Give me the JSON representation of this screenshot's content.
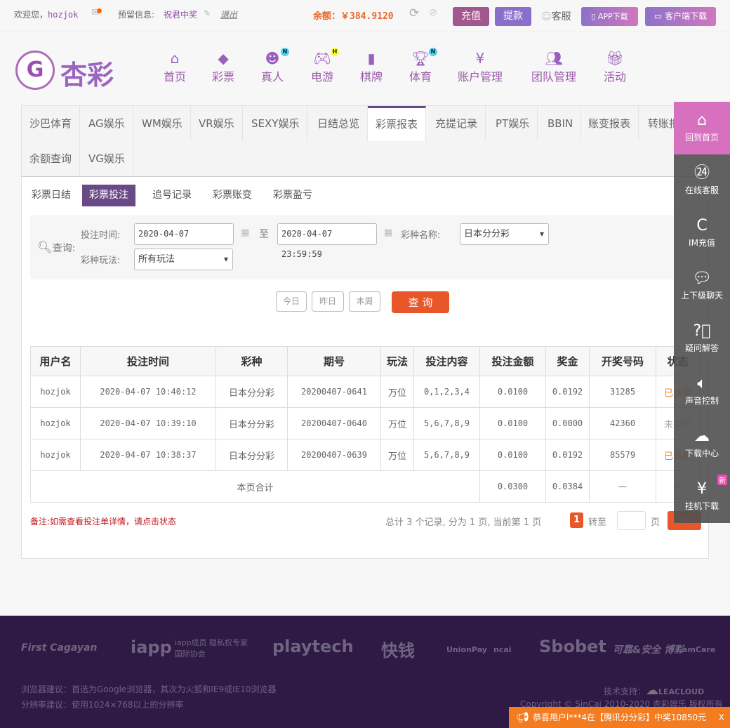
{
  "topbar": {
    "welcome": "欢迎您，",
    "username": "hozjok",
    "reserved_label": "预留信息:",
    "reserved_msg": "祝君中奖",
    "logout": "退出",
    "balance_label": "余额：",
    "balance": "￥384.9120",
    "recharge": "充值",
    "withdraw": "提款",
    "service": "客服",
    "app_download": "APP下载",
    "client_download": "客户端下载"
  },
  "brand": {
    "logo_text": "杏彩"
  },
  "nav": [
    {
      "label": "首页",
      "icon": "home-icon"
    },
    {
      "label": "彩票",
      "icon": "ticket-icon"
    },
    {
      "label": "真人",
      "icon": "live-dealer-icon",
      "badge": "N"
    },
    {
      "label": "电游",
      "icon": "gamepad-icon",
      "badge": "H"
    },
    {
      "label": "棋牌",
      "icon": "cards-icon"
    },
    {
      "label": "体育",
      "icon": "trophy-icon",
      "badge": "N"
    },
    {
      "label": "账户管理",
      "icon": "yen-icon"
    },
    {
      "label": "团队管理",
      "icon": "team-icon"
    },
    {
      "label": "活动",
      "icon": "gift-icon"
    }
  ],
  "tabs": [
    "沙巴体育",
    "AG娱乐",
    "WM娱乐",
    "VR娱乐",
    "SEXY娱乐",
    "日结总览",
    "彩票报表",
    "充提记录",
    "PT娱乐",
    "BBIN",
    "账变报表",
    "转账报表",
    "余额查询",
    "VG娱乐"
  ],
  "active_tab": "彩票报表",
  "subtabs": [
    "彩票日结",
    "彩票投注",
    "追号记录",
    "彩票账变",
    "彩票盈亏"
  ],
  "active_subtab": "彩票投注",
  "query": {
    "label": "查询:",
    "time_label": "投注时间:",
    "start": "2020-04-07 00:00:00",
    "to": "至",
    "end": "2020-04-07 23:59:59",
    "lottery_label": "彩种名称:",
    "lottery": "日本分分彩",
    "play_label": "彩种玩法:",
    "play": "所有玩法",
    "today": "今日",
    "yesterday": "昨日",
    "week": "本周",
    "submit": "查 询"
  },
  "table": {
    "headers": [
      "用户名",
      "投注时间",
      "彩种",
      "期号",
      "玩法",
      "投注内容",
      "投注金额",
      "奖金",
      "开奖号码",
      "状态"
    ],
    "rows": [
      [
        "hozjok",
        "2020-04-07 10:40:12",
        "日本分分彩",
        "20200407-0641",
        "万位",
        "0,1,2,3,4",
        "0.0100",
        "0.0192",
        "31285",
        "已派奖"
      ],
      [
        "hozjok",
        "2020-04-07 10:39:10",
        "日本分分彩",
        "20200407-0640",
        "万位",
        "5,6,7,8,9",
        "0.0100",
        "0.0000",
        "42360",
        "未中奖"
      ],
      [
        "hozjok",
        "2020-04-07 10:38:37",
        "日本分分彩",
        "20200407-0639",
        "万位",
        "5,6,7,8,9",
        "0.0100",
        "0.0192",
        "85579",
        "已派奖"
      ]
    ],
    "total_label": "本页合计",
    "total_amount": "0.0300",
    "total_bonus": "0.0384",
    "dash": "—"
  },
  "note": "备注:如需查看投注单详情，请点击状态",
  "pager": {
    "summary": "总计 3 个记录, 分为 1 页, 当前第 1 页",
    "current": "1",
    "goto": "转至",
    "page_unit": "页",
    "go": "GO"
  },
  "sidebar": [
    {
      "label": "回到首页",
      "icon": "home-icon"
    },
    {
      "label": "在线客服",
      "icon": "headset-24-icon"
    },
    {
      "label": "IM充值",
      "icon": "im-icon"
    },
    {
      "label": "上下级聊天",
      "icon": "chat-icon"
    },
    {
      "label": "疑问解答",
      "icon": "question-icon"
    },
    {
      "label": "声音控制",
      "icon": "speaker-icon"
    },
    {
      "label": "下载中心",
      "icon": "cloud-download-icon"
    },
    {
      "label": "挂机下载",
      "icon": "money-bag-icon",
      "badge": "新"
    }
  ],
  "footer": {
    "partners": [
      "First Cagayan",
      "iapp",
      "iapp成员 隐私权专家国际协会",
      "playtech",
      "快钱",
      "UnionPay",
      "ncai",
      "Sbobet",
      "可靠&安全 博彩",
      "GamCare"
    ],
    "browser": "浏览器建议：首选为Google浏览器，其次为火狐和IE9或IE10浏览器",
    "resolution": "分辨率建议：使用1024×768以上的分辨率",
    "tech": "技术支持：",
    "tech_brand": "LEACLOUD",
    "copyright": "Copyright © SinCai 2010-2020 杏彩娱乐 版权所有"
  },
  "toast": {
    "text": "恭喜用户l***4在【腾讯分分彩】中奖10850元",
    "close": "X"
  },
  "colors": {
    "purple": "#6a4a86",
    "orange": "#e8572a",
    "footer": "#2e1a45",
    "pink": "#d870c0"
  }
}
